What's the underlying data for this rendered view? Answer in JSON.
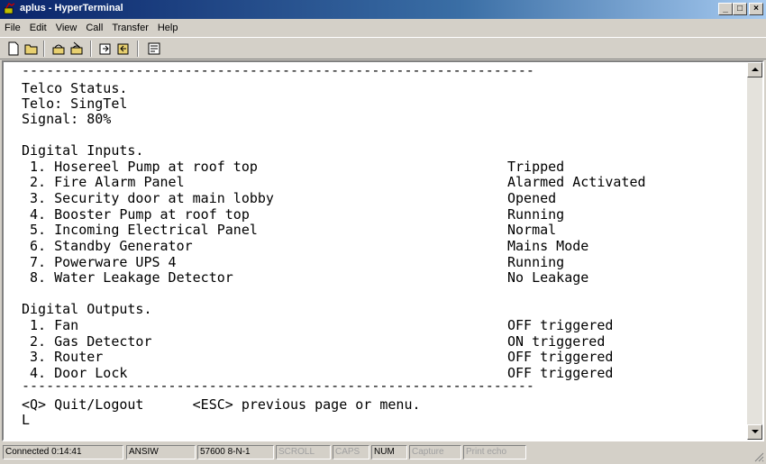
{
  "window": {
    "title": "aplus - HyperTerminal",
    "buttons": {
      "minimize": "_",
      "maximize": "□",
      "close": "×"
    }
  },
  "menu": [
    "File",
    "Edit",
    "View",
    "Call",
    "Transfer",
    "Help"
  ],
  "toolbar": [
    "new-icon",
    "open-icon",
    "connect-icon",
    "disconnect-icon",
    "send-icon",
    "receive-icon",
    "properties-icon"
  ],
  "terminal": {
    "separator_top": "---------------------------------------------------------------",
    "telco_header": "Telco Status.",
    "telco": "Telo: SingTel",
    "signal": "Signal: 80%",
    "inputs_header": "Digital Inputs.",
    "inputs": [
      {
        "label": " 1. Hosereel Pump at roof top",
        "status": "Tripped"
      },
      {
        "label": " 2. Fire Alarm Panel",
        "status": "Alarmed Activated"
      },
      {
        "label": " 3. Security door at main lobby",
        "status": "Opened"
      },
      {
        "label": " 4. Booster Pump at roof top",
        "status": "Running"
      },
      {
        "label": " 5. Incoming Electrical Panel",
        "status": "Normal"
      },
      {
        "label": " 6. Standby Generator",
        "status": "Mains Mode"
      },
      {
        "label": " 7. Powerware UPS 4",
        "status": "Running"
      },
      {
        "label": " 8. Water Leakage Detector",
        "status": "No Leakage"
      }
    ],
    "outputs_header": "Digital Outputs.",
    "outputs": [
      {
        "label": " 1. Fan",
        "status": "OFF triggered"
      },
      {
        "label": " 2. Gas Detector",
        "status": "ON triggered"
      },
      {
        "label": " 3. Router",
        "status": "OFF triggered"
      },
      {
        "label": " 4. Door Lock",
        "status": "OFF triggered"
      }
    ],
    "separator_bottom": "---------------------------------------------------------------",
    "footer": "<Q> Quit/Logout      <ESC> previous page or menu.",
    "cursor": "L"
  },
  "statusbar": {
    "connected": "Connected 0:14:41",
    "emulation": "ANSIW",
    "port": "57600 8-N-1",
    "scroll": "SCROLL",
    "caps": "CAPS",
    "num": "NUM",
    "capture": "Capture",
    "print_echo": "Print echo"
  }
}
